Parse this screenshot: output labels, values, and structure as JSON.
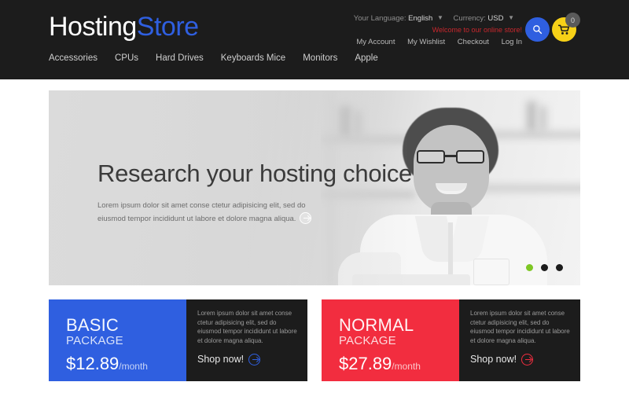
{
  "colors": {
    "header_bg": "#1c1c1c",
    "brand_blue": "#2f5fe0",
    "accent_yellow": "#f7d117",
    "welcome_red": "#c8272d",
    "package_basic_bg": "#2f5fe0",
    "package_normal_bg": "#f22d3f",
    "package_info_bg": "#1c1c1c",
    "dot_active": "#7ec724",
    "dot_inactive": "#1c1c1c"
  },
  "header": {
    "logo": {
      "part1": "Hosting",
      "part2": "Store"
    },
    "language": {
      "label": "Your Language:",
      "value": "English",
      "caret": "chevron-down-icon"
    },
    "currency": {
      "label": "Currency:",
      "value": "USD",
      "caret": "chevron-down-icon"
    },
    "welcome": "Welcome to our online store!",
    "links": [
      {
        "label": "My Account"
      },
      {
        "label": "My Wishlist"
      },
      {
        "label": "Checkout"
      },
      {
        "label": "Log In"
      }
    ],
    "search": {
      "icon": "search-icon"
    },
    "cart": {
      "icon": "cart-icon",
      "count": "0"
    }
  },
  "nav": {
    "items": [
      {
        "label": "Accessories"
      },
      {
        "label": "CPUs"
      },
      {
        "label": "Hard Drives"
      },
      {
        "label": "Keyboards Mice"
      },
      {
        "label": "Monitors"
      },
      {
        "label": "Apple"
      }
    ]
  },
  "hero": {
    "title": "Research your hosting choice",
    "description": "Lorem ipsum dolor sit amet conse ctetur adipisicing elit, sed do eiusmod tempor incididunt ut labore et dolore magna aliqua.",
    "read_more_icon": "arrow-right-circle-icon",
    "slides": [
      {
        "active": true
      },
      {
        "active": false
      },
      {
        "active": false
      }
    ]
  },
  "packages": [
    {
      "name": "BASIC",
      "sub": "PACKAGE",
      "price": "$12.89",
      "per": "/month",
      "description": "Lorem ipsum dolor sit amet conse ctetur adipisicing elit, sed do eiusmod tempor incididunt ut labore et dolore magna aliqua.",
      "cta": "Shop now!",
      "cta_icon": "arrow-right-circle-icon",
      "bg": "#2f5fe0",
      "cta_color": "#2f5fe0"
    },
    {
      "name": "NORMAL",
      "sub": "PACKAGE",
      "price": "$27.89",
      "per": "/month",
      "description": "Lorem ipsum dolor sit amet conse ctetur adipisicing elit, sed do eiusmod tempor incididunt ut labore et dolore magna aliqua.",
      "cta": "Shop now!",
      "cta_icon": "arrow-right-circle-icon",
      "bg": "#f22d3f",
      "cta_color": "#f22d3f"
    }
  ]
}
